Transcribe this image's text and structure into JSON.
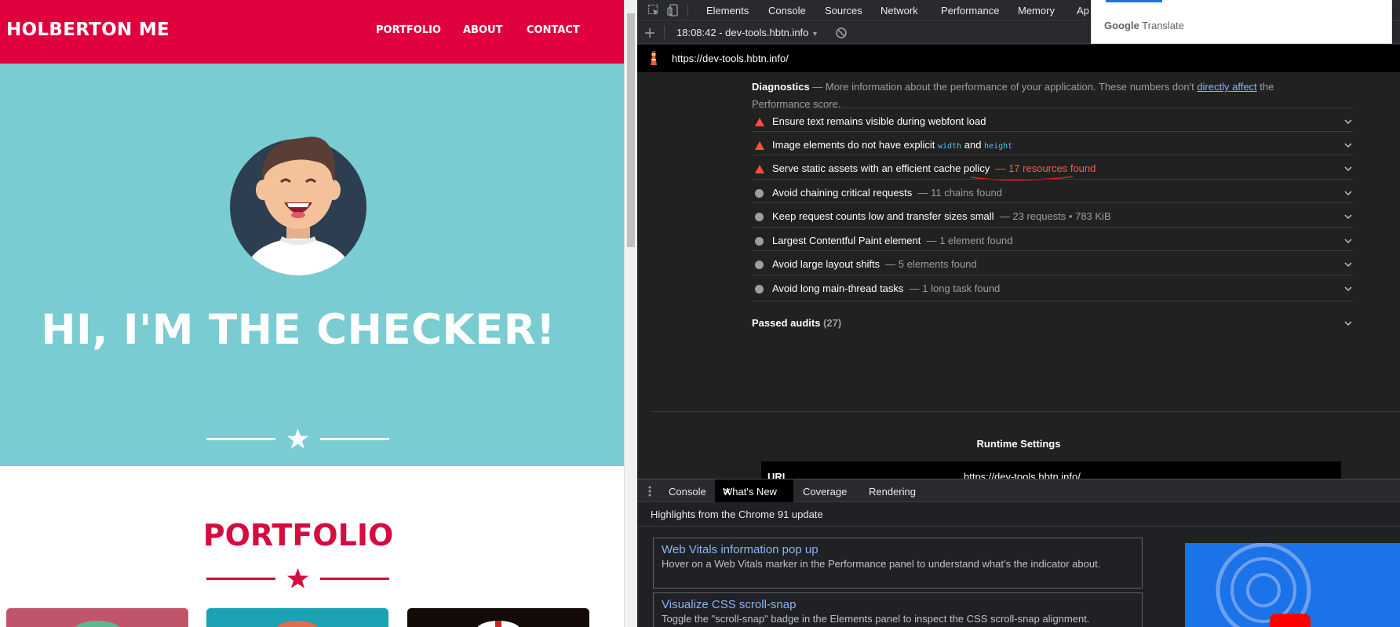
{
  "site": {
    "brand": "HOLBERTON ME",
    "nav": [
      "PORTFOLIO",
      "ABOUT",
      "CONTACT"
    ],
    "hero_title": "HI, I'M THE CHECKER!",
    "portfolio_title": "PORTFOLIO",
    "colors": {
      "brand_red": "#e1003e",
      "hero_teal": "#79ccd1"
    }
  },
  "devtools": {
    "tabs": [
      "Elements",
      "Console",
      "Sources",
      "Network",
      "Performance",
      "Memory",
      "Ap"
    ],
    "report_select": "18:08:42 - dev-tools.hbtn.info",
    "url": "https://dev-tools.hbtn.info/",
    "diagnostics": {
      "title": "Diagnostics",
      "text_before": " — More information about the performance of your application. These numbers don't ",
      "link": "directly affect",
      "text_after": " the Performance score."
    },
    "audits": [
      {
        "title": "Ensure text remains visible during webfont load",
        "display": "",
        "severity": "fail"
      },
      {
        "title_before": "Image elements do not have explicit ",
        "code1": "width",
        "mid": " and ",
        "code2": "height",
        "severity": "fail"
      },
      {
        "title": "Serve static assets with an efficient cache policy",
        "display": "— 17 resources found",
        "severity": "fail"
      },
      {
        "title": "Avoid chaining critical requests",
        "display": "— 11 chains found",
        "severity": "info"
      },
      {
        "title": "Keep request counts low and transfer sizes small",
        "display": "— 23 requests • 783 KiB",
        "severity": "info"
      },
      {
        "title": "Largest Contentful Paint element",
        "display": "— 1 element found",
        "severity": "info"
      },
      {
        "title": "Avoid large layout shifts",
        "display": "— 5 elements found",
        "severity": "info"
      },
      {
        "title": "Avoid long main-thread tasks",
        "display": "— 1 long task found",
        "severity": "info"
      }
    ],
    "passed": {
      "label": "Passed audits",
      "count": "(27)"
    },
    "runtime": {
      "title": "Runtime Settings",
      "label": "URL",
      "value": "https://dev-tools.hbtn.info/"
    },
    "drawer_tabs": [
      "Console",
      "What's New",
      "Coverage",
      "Rendering"
    ],
    "whats_new": {
      "heading": "Highlights from the Chrome 91 update",
      "cards": [
        {
          "title": "Web Vitals information pop up",
          "desc": "Hover on a Web Vitals marker in the Performance panel to understand what’s the indicator about."
        },
        {
          "title": "Visualize CSS scroll-snap",
          "desc": "Toggle the \"scroll-snap\" badge in the Elements panel to inspect the CSS scroll-snap alignment."
        }
      ]
    },
    "translate": {
      "brand": "Google",
      "label": "Translate"
    }
  }
}
